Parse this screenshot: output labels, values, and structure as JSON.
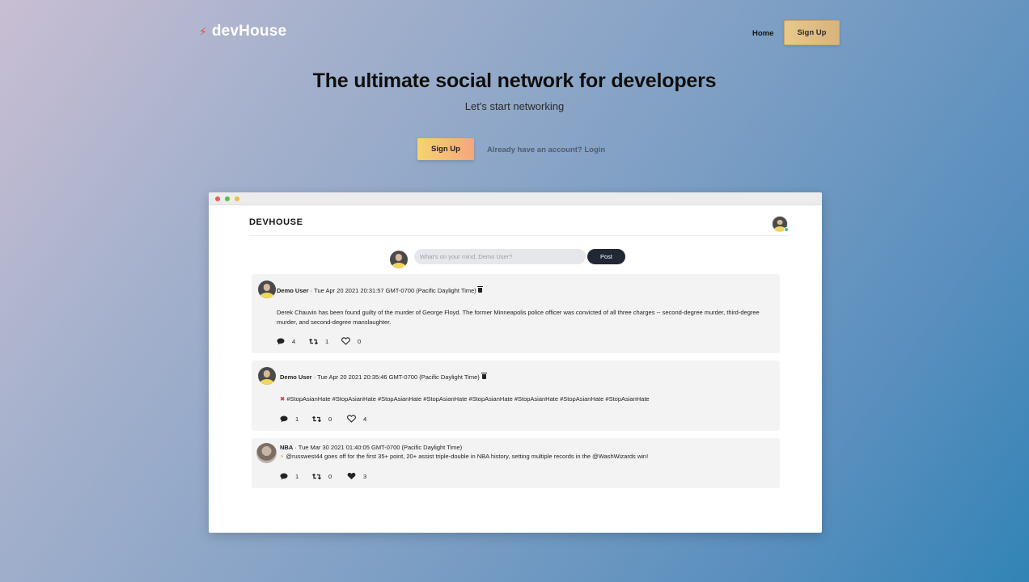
{
  "nav": {
    "brand_icon": "bolt-icon",
    "brand": "devHouse",
    "home": "Home",
    "signup": "Sign Up"
  },
  "hero": {
    "title": "The ultimate social network for developers",
    "subtitle": "Let's start networking",
    "signup": "Sign Up",
    "login": "Already have an account? Login"
  },
  "preview": {
    "logo": "DEVHOUSE",
    "composer": {
      "placeholder": "What's on your mind, Demo User?",
      "post": "Post"
    },
    "posts": [
      {
        "author": "Demo User",
        "timestamp": " · Tue Apr 20 2021 20:31:57 GMT-0700 (Pacific Daylight Time)",
        "body": "Derek Chauvin has been found guilty of the murder of George Floyd. The former Minneapolis police officer was convicted of all three charges -- second-degree murder, third-degree murder, and second-degree manslaughter.",
        "comments": "4",
        "retweets": "1",
        "likes": "0",
        "liked": false
      },
      {
        "author": "Demo User",
        "timestamp": " · Tue Apr 20 2021 20:35:46 GMT-0700 (Pacific Daylight Time)",
        "emoji": "✖",
        "body": "#StopAsianHate #StopAsianHate #StopAsianHate #StopAsianHate #StopAsianHate #StopAsianHate #StopAsianHate #StopAsianHate",
        "comments": "1",
        "retweets": "0",
        "likes": "4",
        "liked": false
      },
      {
        "author": "NBA",
        "timestamp": " · Tue Mar 30 2021 01:40:05 GMT-0700 (Pacific Daylight Time)",
        "emoji": "⚡",
        "body": "@russwest44 goes off for the first 35+ point, 20+ assist triple-double in NBA history, setting multiple records in the @WashWizards win!",
        "comments": "1",
        "retweets": "0",
        "likes": "3",
        "liked": true
      }
    ]
  }
}
